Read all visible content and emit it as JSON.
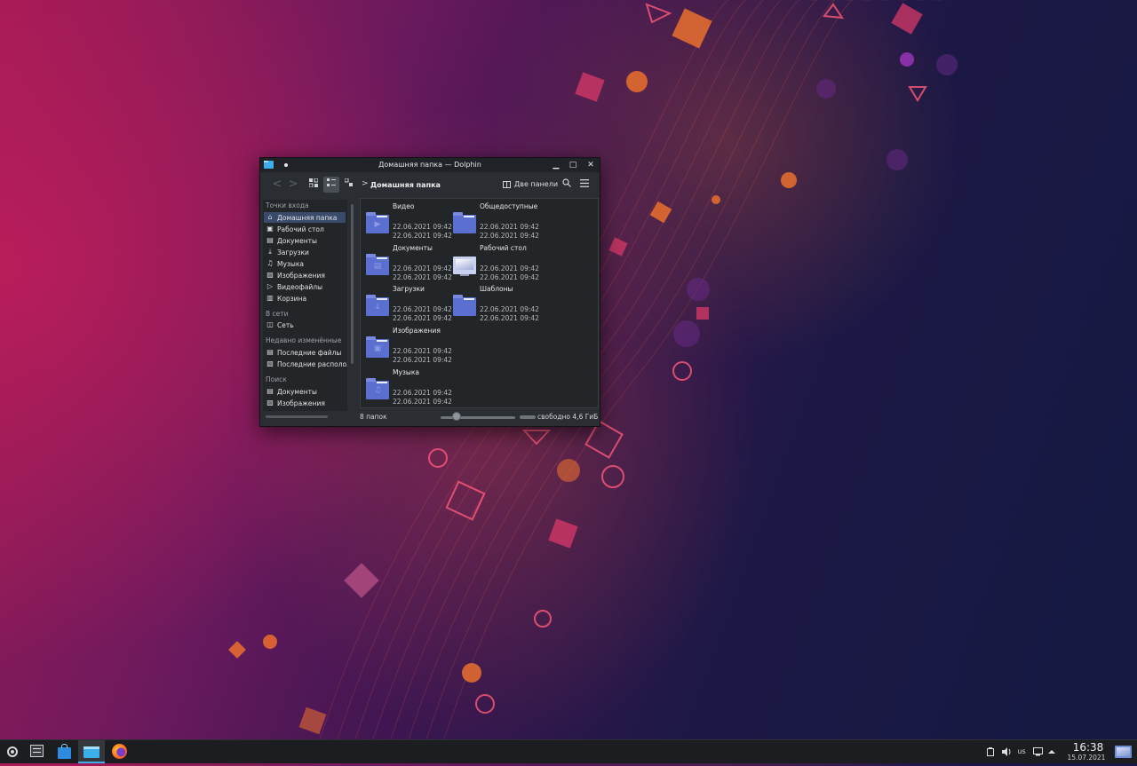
{
  "window": {
    "title": "Домашняя папка — Dolphin",
    "minimize_glyph": "▁",
    "maximize_glyph": "□",
    "close_glyph": "✕"
  },
  "toolbar": {
    "back_glyph": "<",
    "forward_glyph": ">",
    "breadcrumb_sep": ">",
    "breadcrumb": "Домашняя папка",
    "split_label": "Две панели"
  },
  "sidebar": {
    "sections": [
      {
        "header": "Точки входа",
        "items": [
          {
            "label": "Домашняя папка",
            "icon": "home-icon",
            "selected": true
          },
          {
            "label": "Рабочий стол",
            "icon": "desktop-icon"
          },
          {
            "label": "Документы",
            "icon": "document-icon"
          },
          {
            "label": "Загрузки",
            "icon": "download-icon"
          },
          {
            "label": "Музыка",
            "icon": "music-icon"
          },
          {
            "label": "Изображения",
            "icon": "image-icon"
          },
          {
            "label": "Видеофайлы",
            "icon": "video-icon"
          },
          {
            "label": "Корзина",
            "icon": "trash-icon"
          }
        ]
      },
      {
        "header": "В сети",
        "items": [
          {
            "label": "Сеть",
            "icon": "network-icon"
          }
        ]
      },
      {
        "header": "Недавно изменённые",
        "items": [
          {
            "label": "Последние файлы",
            "icon": "recent-files-icon"
          },
          {
            "label": "Последние располож",
            "icon": "recent-locations-icon"
          }
        ]
      },
      {
        "header": "Поиск",
        "items": [
          {
            "label": "Документы",
            "icon": "document-icon"
          },
          {
            "label": "Изображения",
            "icon": "image-icon"
          }
        ]
      }
    ]
  },
  "files": [
    {
      "name": "Видео",
      "icon": "folder-video-icon",
      "glyph": "▶",
      "modified": "22.06.2021 09:42",
      "accessed": "22.06.2021 09:42"
    },
    {
      "name": "Общедоступные",
      "icon": "folder-public-icon",
      "glyph": "",
      "modified": "22.06.2021 09:42",
      "accessed": "22.06.2021 09:42"
    },
    {
      "name": "Документы",
      "icon": "folder-documents-icon",
      "glyph": "▤",
      "modified": "22.06.2021 09:42",
      "accessed": "22.06.2021 09:42"
    },
    {
      "name": "Рабочий стол",
      "icon": "desktop-folder-icon",
      "glyph": "",
      "modified": "22.06.2021 09:42",
      "accessed": "22.06.2021 09:42"
    },
    {
      "name": "Загрузки",
      "icon": "folder-downloads-icon",
      "glyph": "↓",
      "modified": "22.06.2021 09:42",
      "accessed": "22.06.2021 09:42"
    },
    {
      "name": "Шаблоны",
      "icon": "folder-templates-icon",
      "glyph": "",
      "modified": "22.06.2021 09:42",
      "accessed": "22.06.2021 09:42"
    },
    {
      "name": "Изображения",
      "icon": "folder-pictures-icon",
      "glyph": "▣",
      "modified": "22.06.2021 09:42",
      "accessed": "22.06.2021 09:42"
    },
    {
      "name": "Музыка",
      "icon": "folder-music-icon",
      "glyph": "♫",
      "modified": "22.06.2021 09:42",
      "accessed": "22.06.2021 09:42"
    }
  ],
  "status": {
    "folder_count": "8 папок",
    "free_space": "свободно 4,6 ГиБ"
  },
  "taskbar": {
    "keyboard_layout": "us",
    "time": "16:38",
    "date": "15.07.2021"
  },
  "colors": {
    "accent": "#3daee9",
    "folder": "#5a6fd0",
    "selection": "#3a4a6a"
  }
}
